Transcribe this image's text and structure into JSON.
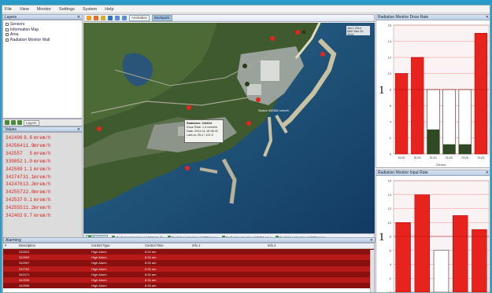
{
  "menu": [
    "File",
    "View",
    "Monitor",
    "Settings",
    "System",
    "Help"
  ],
  "layers": {
    "title": "Layers",
    "items": [
      "Sensors",
      "Information Map",
      "Area",
      "Radiation Monitor Wall"
    ],
    "tab": "Layers"
  },
  "values": {
    "title": "Values",
    "rows": [
      {
        "id": "342496",
        "value": "8.8",
        "unit": "mrem/h"
      },
      {
        "id": "342564",
        "value": "11.9",
        "unit": "mrem/h"
      },
      {
        "id": "342557",
        "value": "5",
        "unit": "mrem/h"
      },
      {
        "id": "339852",
        "value": "1.0",
        "unit": "mrem/h"
      },
      {
        "id": "342589",
        "value": "1.1",
        "unit": "mrem/h"
      },
      {
        "id": "342747",
        "value": "31.1",
        "unit": "mrem/h"
      },
      {
        "id": "342476",
        "value": "13.2",
        "unit": "mrem/h"
      },
      {
        "id": "342557",
        "value": "22.0",
        "unit": "mrem/h"
      },
      {
        "id": "342537",
        "value": "0.1",
        "unit": "mrem/h"
      },
      {
        "id": "342555",
        "value": "11.2",
        "unit": "mrem/h"
      },
      {
        "id": "342402",
        "value": "9.7",
        "unit": "mrem/h"
      }
    ]
  },
  "toolbar": {
    "btn1": "Animation",
    "btn2": "Backpack"
  },
  "map": {
    "popup": {
      "title": "Radiation: 342624",
      "line1": "Dose Rate: 1.4 mrem/h",
      "line2": "Date: 2014-11-18 08:42",
      "line3": "Lat/Lon 25.4 / 121.5"
    },
    "label1": "Station 342563 mrem/h",
    "legend_title": "Jan 1 2014",
    "legend_sub": "MKE Mar 22, 2014",
    "tabs": [
      "Overview",
      "Radiation Monitor HighTM Radio",
      "Radiation Monitor HighTM Area",
      "Radiation Monitor HighTM Area",
      "Radiation Monitor HighTM Area"
    ]
  },
  "alarm": {
    "title": "Alarming",
    "headers": [
      "#",
      "Description",
      "Control Type",
      "Control Time",
      "Info 1",
      "Info 2"
    ],
    "rows": [
      [
        "",
        "342624",
        "High Alarm",
        "8.54 am",
        "",
        ""
      ],
      [
        "",
        "342509",
        "High Alarm",
        "8.54 am",
        "",
        ""
      ],
      [
        "",
        "342557",
        "High Alarm",
        "8.54 am",
        "",
        ""
      ],
      [
        "",
        "342762",
        "High Alarm",
        "8.54 am",
        "",
        ""
      ],
      [
        "",
        "342471",
        "High Alarm",
        "8.54 am",
        "",
        ""
      ],
      [
        "",
        "342539",
        "High Alarm",
        "8.54 am",
        "",
        ""
      ],
      [
        "",
        "342555",
        "High Alarm",
        "8.54 am",
        "",
        ""
      ]
    ]
  },
  "colors": {
    "red": "#e8231d",
    "dark_green": "#2f4a23",
    "threshold": "#c0c0c0",
    "alarm_row": "#8a0f0f",
    "alarm_row_alt": "#b81a1a"
  },
  "chart_data": [
    {
      "type": "bar",
      "title": "Radiation Monitor Dose Rate",
      "xlabel": "Device",
      "categories": [
        "SLVD",
        "SLVD",
        "SLVD",
        "SLVD",
        "SLVD",
        "SLVD"
      ],
      "values": [
        10,
        12,
        8,
        8,
        8,
        15
      ],
      "fill_fraction": [
        1,
        1,
        0.38,
        0.15,
        0.15,
        1
      ],
      "ylim": [
        0,
        16
      ],
      "yticks": [
        0,
        2,
        4,
        6,
        8,
        10,
        12,
        14,
        16
      ],
      "threshold": 8
    },
    {
      "type": "bar",
      "title": "Radiation Monitor Input Rate",
      "categories": [
        "SLVD",
        "SLVD",
        "SLVD",
        "SLVD",
        "SLVD"
      ],
      "values": [
        10,
        14,
        6,
        11,
        9
      ],
      "fill_fraction": [
        1,
        1,
        0,
        1,
        1
      ],
      "ylim": [
        0,
        16
      ],
      "yticks": [
        0,
        2,
        4,
        6,
        8,
        10,
        12,
        14,
        16
      ],
      "threshold": 8
    }
  ]
}
